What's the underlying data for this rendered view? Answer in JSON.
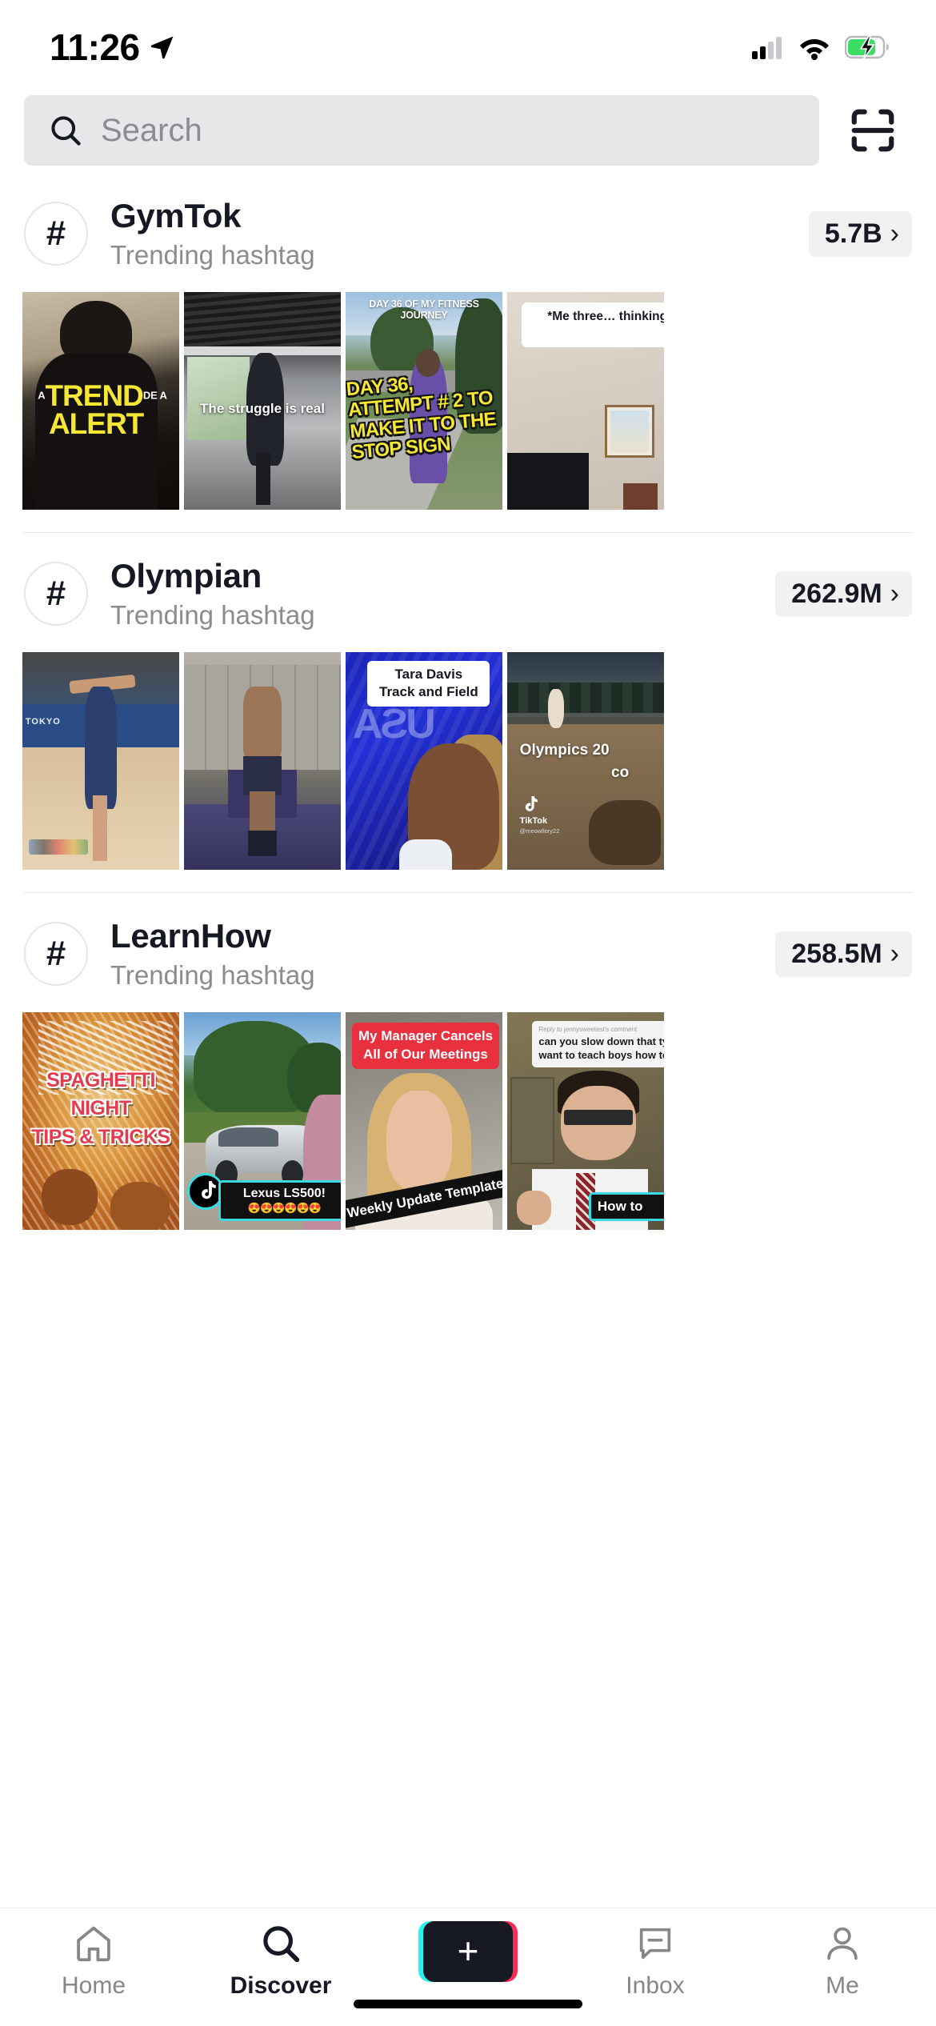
{
  "status_bar": {
    "time": "11:26",
    "location_icon": "location-arrow-icon",
    "cellular_icon": "cellular-signal-icon",
    "wifi_icon": "wifi-icon",
    "battery_icon": "battery-charging-icon"
  },
  "header": {
    "search_placeholder": "Search",
    "search_value": "",
    "search_icon": "search-icon",
    "scan_icon": "scan-qr-icon"
  },
  "sections": [
    {
      "hash_symbol": "#",
      "title": "GymTok",
      "subtitle": "Trending hashtag",
      "count": "5.7B",
      "chevron": "›",
      "videos": [
        {
          "overlay_small_left": "A",
          "overlay_big": "TREND",
          "overlay_small_right": "DE A",
          "overlay_line2": "ALERT"
        },
        {
          "overlay_text": "The struggle is real"
        },
        {
          "overlay_top": "DAY 36 OF MY FITNESS JOURNEY",
          "overlay_body": "DAY 36, ATTEMPT # 2 TO MAKE IT TO THE STOP SIGN"
        },
        {
          "overlay_bubble": "*Me three… thinking liftin… fem…"
        }
      ]
    },
    {
      "hash_symbol": "#",
      "title": "Olympian",
      "subtitle": "Trending hashtag",
      "count": "262.9M",
      "chevron": "›",
      "videos": [
        {
          "overlay_text": "TOKYO"
        },
        {
          "overlay_text": ""
        },
        {
          "overlay_bubble_line1": "Tara Davis",
          "overlay_bubble_line2": "Track and Field",
          "backdrop_text": "USA"
        },
        {
          "overlay_line1": "Olympics 20",
          "overlay_line2": "co",
          "watermark_label": "TikTok",
          "watermark_user": "@meowllory22"
        }
      ]
    },
    {
      "hash_symbol": "#",
      "title": "LearnHow",
      "subtitle": "Trending hashtag",
      "count": "258.5M",
      "chevron": "›",
      "videos": [
        {
          "overlay_line1": "SPAGHETTI",
          "overlay_line2": "NIGHT",
          "overlay_line3": "TIPS & TRICKS"
        },
        {
          "plate_name": "Lexus LS500!",
          "plate_emoji": "😍😍😍😍😍😍"
        },
        {
          "overlay_title": "My Manager Cancels All of Our Meetings",
          "overlay_band": "Weekly Update Template"
        },
        {
          "reply_label": "Reply to jennysweetest's comment",
          "reply_body": "can you slow down that tying? I want to teach boys how to do it that",
          "how_label": "How to"
        }
      ]
    }
  ],
  "tabbar": {
    "items": [
      {
        "label": "Home",
        "icon": "home-icon",
        "active": false
      },
      {
        "label": "Discover",
        "icon": "search-icon",
        "active": true
      },
      {
        "label": "",
        "icon": "create-plus-icon",
        "active": false
      },
      {
        "label": "Inbox",
        "icon": "inbox-message-icon",
        "active": false
      },
      {
        "label": "Me",
        "icon": "person-icon",
        "active": false
      }
    ],
    "create_plus": "+"
  },
  "colors": {
    "tiktok_cyan": "#26f4ee",
    "tiktok_pink": "#fe2c55",
    "text_primary": "#161823",
    "text_secondary": "#8b8b90",
    "search_bg": "#e7e7e9",
    "pill_bg": "#f1f1f2",
    "accent_yellow": "#f5e733",
    "accent_red": "#e23c4e"
  }
}
